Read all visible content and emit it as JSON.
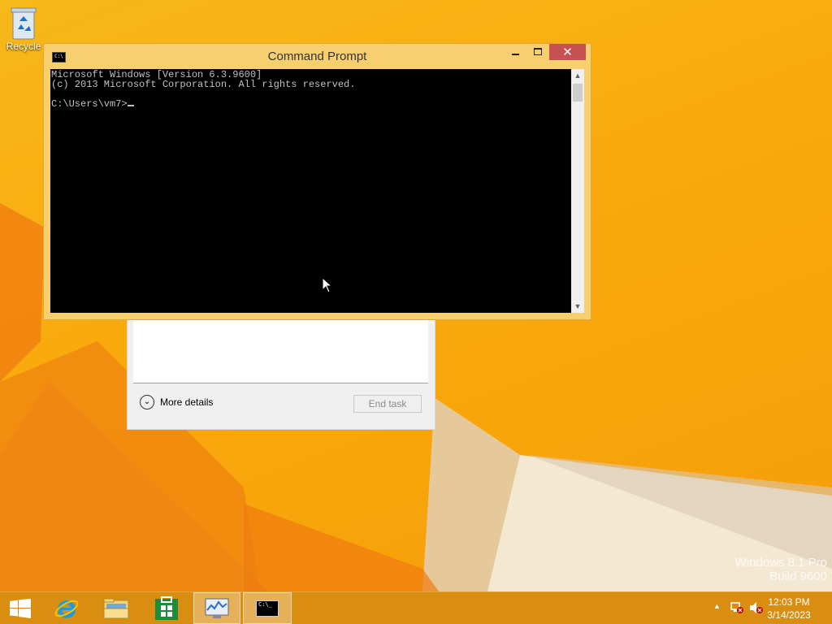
{
  "desktop": {
    "icons": [
      {
        "label": "Recycle",
        "icon": "recycle-bin-icon"
      }
    ],
    "watermark": {
      "line1": "Windows 8.1 Pro",
      "line2": "Build 9600"
    }
  },
  "task_manager": {
    "more_details_label": "More details",
    "end_task_label": "End task"
  },
  "cmd_window": {
    "title": "Command Prompt",
    "console_lines": [
      "Microsoft Windows [Version 6.3.9600]",
      "(c) 2013 Microsoft Corporation. All rights reserved.",
      "",
      "C:\\Users\\vm7>"
    ],
    "icon_text": "C:\\"
  },
  "taskbar": {
    "items": [
      {
        "name": "start",
        "icon": "windows-logo-icon"
      },
      {
        "name": "internet-explorer",
        "icon": "internet-explorer-icon"
      },
      {
        "name": "file-explorer",
        "icon": "folder-icon"
      },
      {
        "name": "store",
        "icon": "store-icon"
      },
      {
        "name": "performance-monitor",
        "icon": "performance-monitor-icon"
      },
      {
        "name": "command-prompt",
        "icon": "command-prompt-icon",
        "active": true
      }
    ],
    "cmd_icon_text": "C:\\_",
    "clock": {
      "time": "12:03 PM",
      "date": "3/14/2023"
    }
  },
  "colors": {
    "desktop_bg": "#f9a90c",
    "window_frame": "#f7cf6e",
    "close_button": "#c75050",
    "taskbar": "#d98e12"
  }
}
